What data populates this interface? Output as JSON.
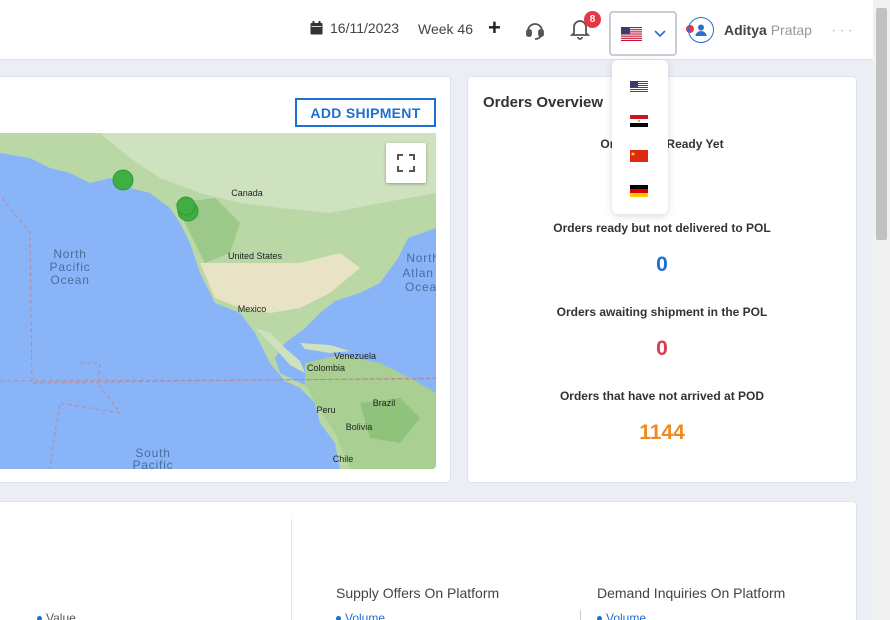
{
  "header": {
    "date": "16/11/2023",
    "week": "Week 46",
    "notification_count": "8",
    "user_first": "Aditya",
    "user_last": "Pratap",
    "more": "···"
  },
  "language": {
    "selected": "us-flag-icon",
    "options": [
      "us-flag-icon",
      "egypt-flag-icon",
      "china-flag-icon",
      "germany-flag-icon"
    ]
  },
  "map_card": {
    "add_shipment": "ADD SHIPMENT",
    "labels": {
      "north_pacific": [
        "North",
        "Pacific",
        "Ocean"
      ],
      "north_atlantic": [
        "North",
        "Atlan",
        "Ocea"
      ],
      "south_pacific": [
        "South",
        "Pacific"
      ],
      "canada": "Canada",
      "united_states": "United States",
      "mexico": "Mexico",
      "venezuela": "Venezuela",
      "colombia": "Colombia",
      "brazil": "Brazil",
      "peru": "Peru",
      "bolivia": "Bolivia",
      "chile": "Chile"
    }
  },
  "orders": {
    "title": "Orders Overview",
    "first_label_left": "Or",
    "first_label_right": "Ready Yet",
    "items": [
      {
        "label": "Orders ready but not delivered to POL",
        "value": "0",
        "color": "#1d6fd1"
      },
      {
        "label": "Orders awaiting shipment in the POL",
        "value": "0",
        "color": "#e03a4e"
      },
      {
        "label": "Orders that have not arrived at POD",
        "value": "1144",
        "color": "#ef8a22"
      }
    ]
  },
  "bottom": {
    "supply_title": "Supply Offers On Platform",
    "demand_title": "Demand Inquiries On Platform",
    "legend_value": "Value",
    "legend_volume": "Volume"
  }
}
